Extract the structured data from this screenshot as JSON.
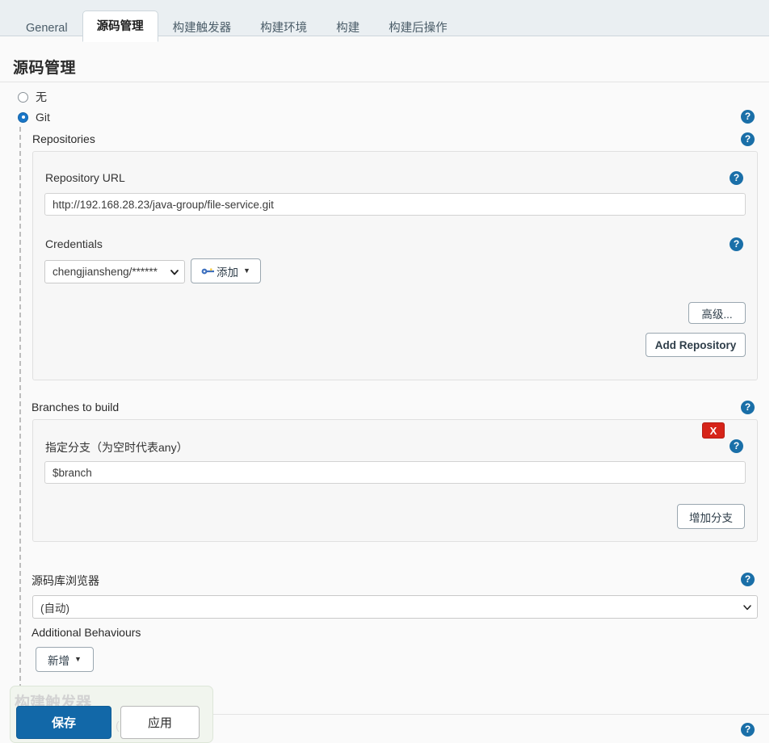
{
  "tabs": [
    {
      "label": "General",
      "active": false
    },
    {
      "label": "源码管理",
      "active": true
    },
    {
      "label": "构建触发器",
      "active": false
    },
    {
      "label": "构建环境",
      "active": false
    },
    {
      "label": "构建",
      "active": false
    },
    {
      "label": "构建后操作",
      "active": false
    }
  ],
  "section": {
    "title": "源码管理"
  },
  "scm": {
    "option_none": "无",
    "option_git": "Git",
    "selected": "Git"
  },
  "repositories": {
    "label": "Repositories",
    "repository_url": {
      "label": "Repository URL",
      "value": "http://192.168.28.23/java-group/file-service.git"
    },
    "credentials": {
      "label": "Credentials",
      "value": "chengjiansheng/******",
      "add_button": "添加"
    },
    "advanced_button": "高级...",
    "add_repository_button": "Add Repository"
  },
  "branches": {
    "label": "Branches to build",
    "delete_button": "X",
    "specifier": {
      "label": "指定分支（为空时代表any）",
      "value": "$branch"
    },
    "add_branch_button": "增加分支"
  },
  "repo_browser": {
    "label": "源码库浏览器",
    "value": "(自动)"
  },
  "additional_behaviours": {
    "label": "Additional Behaviours",
    "add_button": "新增"
  },
  "next_section": {
    "title": "构建触发器",
    "ghost_text": "("
  },
  "footer": {
    "save": "保存",
    "apply": "应用"
  },
  "icons": {
    "help": "?",
    "key": "key-icon",
    "caret": "▼"
  },
  "colors": {
    "accent": "#1268a8",
    "danger": "#d62419",
    "tabbar": "#eaeff2",
    "panel": "#f7f7f7"
  }
}
